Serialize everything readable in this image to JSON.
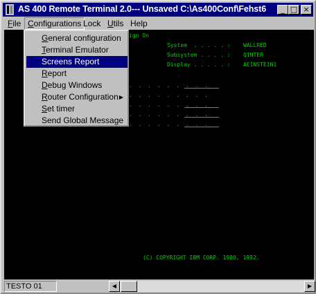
{
  "window": {
    "title": "AS 400 Remote Terminal 2.0--- Unsaved C:\\As400Conf\\Fehst6",
    "controls": {
      "minimize": "_",
      "maximize": "□",
      "close": "×"
    }
  },
  "menubar": {
    "items": [
      {
        "label": "File",
        "accel": "F",
        "rest": "ile"
      },
      {
        "label": "Configurations",
        "accel": "C",
        "rest": "onfigurations"
      },
      {
        "label": "Lock",
        "accel": "",
        "rest": "Lock"
      },
      {
        "label": "Utils",
        "accel": "U",
        "rest": "tils"
      },
      {
        "label": "Help",
        "accel": "",
        "rest": "Help"
      }
    ]
  },
  "dropdown": {
    "items": [
      {
        "accel": "G",
        "rest": "eneral configuration"
      },
      {
        "accel": "T",
        "rest": "erminal Emulator"
      },
      {
        "accel": "",
        "rest": "Screens Report"
      },
      {
        "accel": "R",
        "rest": "eport"
      },
      {
        "accel": "D",
        "rest": "ebug Windows"
      },
      {
        "accel": "R",
        "rest": "outer Configuration"
      },
      {
        "accel": "S",
        "rest": "et timer"
      },
      {
        "accel": "",
        "rest": "Send Global Message"
      }
    ],
    "submenu_arrow": "▶"
  },
  "terminal": {
    "signon": "ign On",
    "system_label": "System  . . . . . :",
    "system_value": "WALLRED",
    "subsystem_label": "Subsystem . . . . :",
    "subsystem_value": "QINTER",
    "display_label": "Display . . . . . :",
    "display_value": "AEINSTEIN1",
    "dots": ". . . . . . . . .",
    "copyright": "(C) COPYRIGHT IBM CORP. 1980, 1992."
  },
  "statusbar": {
    "session": "TESTO 01",
    "left_arrow": "◀",
    "right_arrow": "▶"
  }
}
